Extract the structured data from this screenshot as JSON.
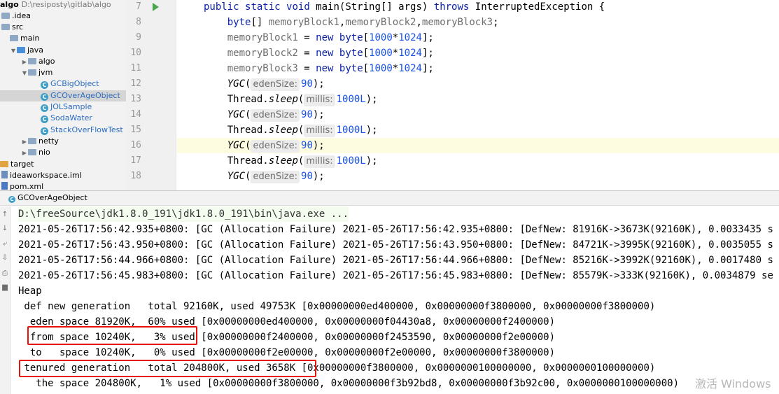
{
  "tree": {
    "root": {
      "name": "algo",
      "path": "D:\\resiposty\\gitlab\\algo"
    },
    "items": [
      {
        "label": ".idea"
      },
      {
        "label": "src"
      },
      {
        "label": "main"
      },
      {
        "label": "java"
      },
      {
        "label": "algo"
      },
      {
        "label": "jvm"
      },
      {
        "label": "GCBigObject"
      },
      {
        "label": "GCOverAgeObject"
      },
      {
        "label": "JOLSample"
      },
      {
        "label": "SodaWater"
      },
      {
        "label": "StackOverFlowTest"
      },
      {
        "label": "netty"
      },
      {
        "label": "nio"
      },
      {
        "label": "target"
      },
      {
        "label": "ideaworkspace.iml"
      },
      {
        "label": "pom.xml"
      }
    ]
  },
  "editor": {
    "line_numbers": [
      "7",
      "8",
      "9",
      "10",
      "11",
      "12",
      "13",
      "14",
      "15",
      "16",
      "17",
      "18"
    ],
    "lines": [
      [
        "public",
        " ",
        "static",
        " ",
        "void",
        " main(String[] args) ",
        "throws",
        " InterruptedException {"
      ],
      [
        "    ",
        "byte",
        "[] ",
        "memoryBlock1",
        ",",
        "memoryBlock2",
        ",",
        "memoryBlock3",
        ";"
      ],
      [
        "    ",
        "memoryBlock1",
        " = ",
        "new",
        " ",
        "byte",
        "[",
        "1000",
        "*",
        "1024",
        "];"
      ],
      [
        "    ",
        "memoryBlock2",
        " = ",
        "new",
        " ",
        "byte",
        "[",
        "1000",
        "*",
        "1024",
        "];"
      ],
      [
        "    ",
        "memoryBlock3",
        " = ",
        "new",
        " ",
        "byte",
        "[",
        "1000",
        "*",
        "1024",
        "];"
      ],
      [
        "    ",
        "YGC",
        "(",
        "edenSize:",
        "90",
        ");"
      ],
      [
        "    ",
        "Thread.",
        "sleep",
        "(",
        "millis:",
        "1000L",
        ");"
      ],
      [
        "    ",
        "YGC",
        "(",
        "edenSize:",
        "90",
        ");"
      ],
      [
        "    ",
        "Thread.",
        "sleep",
        "(",
        "millis:",
        "1000L",
        ");"
      ],
      [
        "    ",
        "YGC",
        "(",
        "edenSize:",
        "90",
        ");"
      ],
      [
        "    ",
        "Thread.",
        "sleep",
        "(",
        "millis:",
        "1000L",
        ");"
      ],
      [
        "    ",
        "YGC",
        "(",
        "edenSize:",
        "90",
        ");"
      ]
    ]
  },
  "run": {
    "tab_label": "GCOverAgeObject",
    "console": [
      "D:\\freeSource\\jdk1.8.0_191\\jdk1.8.0_191\\bin\\java.exe ...",
      "2021-05-26T17:56:42.935+0800: [GC (Allocation Failure) 2021-05-26T17:56:42.935+0800: [DefNew: 81916K->3673K(92160K), 0.0033435 s",
      "2021-05-26T17:56:43.950+0800: [GC (Allocation Failure) 2021-05-26T17:56:43.950+0800: [DefNew: 84721K->3995K(92160K), 0.0035055 s",
      "2021-05-26T17:56:44.966+0800: [GC (Allocation Failure) 2021-05-26T17:56:44.966+0800: [DefNew: 85216K->3992K(92160K), 0.0017480 s",
      "2021-05-26T17:56:45.983+0800: [GC (Allocation Failure) 2021-05-26T17:56:45.983+0800: [DefNew: 85579K->333K(92160K), 0.0034879 se",
      "Heap",
      " def new generation   total 92160K, used 49753K [0x00000000ed400000, 0x00000000f3800000, 0x00000000f3800000)",
      "  eden space 81920K,  60% used [0x00000000ed400000, 0x00000000f04430a8, 0x00000000f2400000)",
      "  from space 10240K,   3% used [0x00000000f2400000, 0x00000000f2453590, 0x00000000f2e00000)",
      "  to   space 10240K,   0% used [0x00000000f2e00000, 0x00000000f2e00000, 0x00000000f3800000)",
      " tenured generation   total 204800K, used 3658K [0x00000000f3800000, 0x0000000100000000, 0x0000000100000000)",
      "   the space 204800K,   1% used [0x00000000f3800000, 0x00000000f3b92bd8, 0x00000000f3b92c00, 0x0000000100000000)"
    ]
  },
  "watermark": "激活 Windows"
}
